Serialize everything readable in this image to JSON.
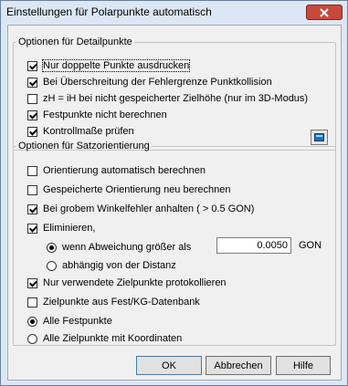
{
  "window": {
    "title": "Einstellungen für Polarpunkte automatisch",
    "close_icon": "close-icon",
    "close_color": "#c8493b"
  },
  "detail_group": {
    "legend": "Optionen für Detailpunkte",
    "options": [
      {
        "label": "Nur doppelte Punkte ausdrucken",
        "checked": true
      },
      {
        "label": "Bei Überschreitung der Fehlergrenze Punktkollision",
        "checked": true
      },
      {
        "label": "zH = iH bei nicht gespeicherter Zielhöhe (nur im 3D-Modus)",
        "checked": false
      },
      {
        "label": "Festpunkte nicht berechnen",
        "checked": true
      },
      {
        "label": "Kontrollmaße prüfen",
        "checked": true
      }
    ],
    "tool_icon": "monitor-icon"
  },
  "orient_group": {
    "legend": "Optionen für Satzorientierung",
    "options": [
      {
        "label": "Orientierung automatisch berechnen",
        "checked": false
      },
      {
        "label": "Gespeicherte Orientierung neu berechnen",
        "checked": false
      },
      {
        "label": "Bei grobem Winkelfehler anhalten ( > 0.5 GON)",
        "checked": true
      },
      {
        "label": "Eliminieren,",
        "checked": true
      }
    ],
    "eliminate_modes": [
      {
        "label": "wenn Abweichung größer als",
        "selected": true
      },
      {
        "label": "abhängig von der Distanz",
        "selected": false
      }
    ],
    "threshold_value": "0.0050",
    "threshold_unit": "GON",
    "log_option": {
      "label": "Nur verwendete Zielpunkte protokollieren",
      "checked": true
    },
    "db_option": {
      "label": "Zielpunkte aus Fest/KG-Datenbank",
      "checked": false
    },
    "point_modes": [
      {
        "label": "Alle Festpunkte",
        "selected": true
      },
      {
        "label": "Alle Zielpunkte mit Koordinaten",
        "selected": false
      }
    ]
  },
  "buttons": {
    "ok": "OK",
    "cancel": "Abbrechen",
    "help": "Hilfe"
  }
}
